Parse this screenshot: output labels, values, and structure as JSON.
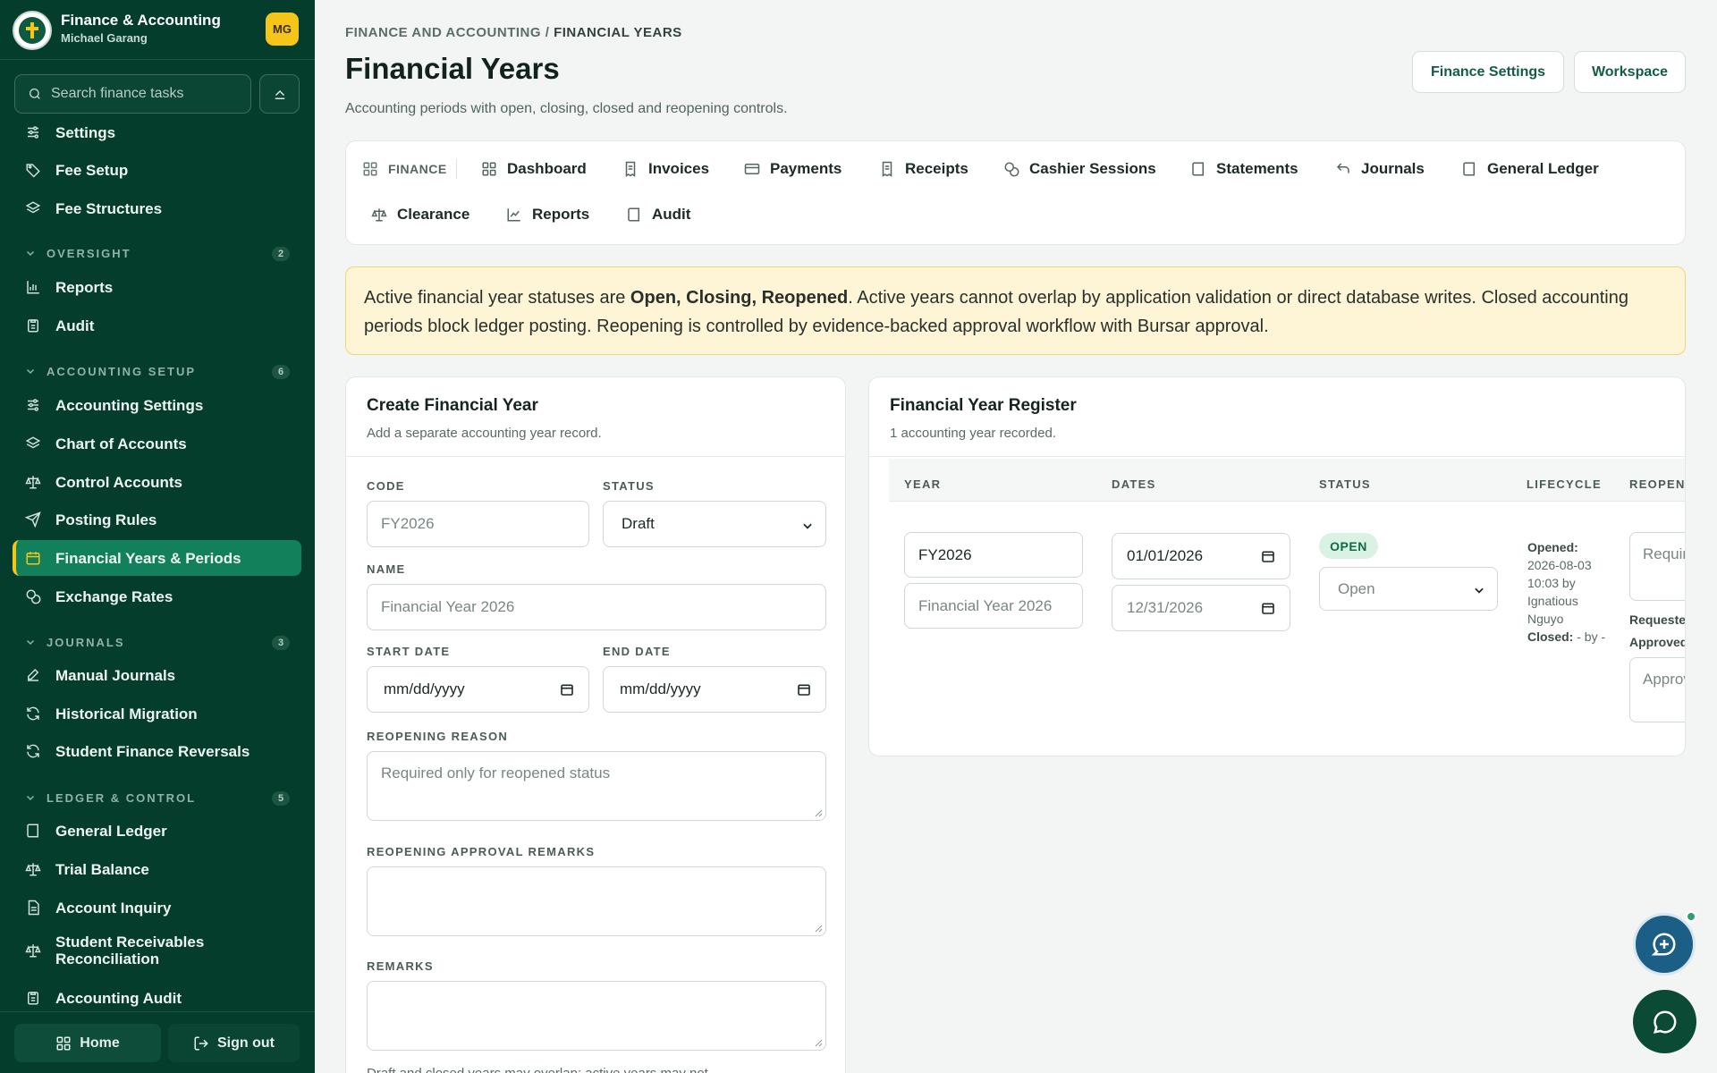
{
  "app": {
    "title": "Finance & Accounting",
    "user": "Michael Garang",
    "initials": "MG"
  },
  "sidebar": {
    "search_placeholder": "Search finance tasks",
    "top_items": [
      {
        "label": "Settings",
        "icon": "sliders-icon"
      },
      {
        "label": "Fee Setup",
        "icon": "tag-icon"
      },
      {
        "label": "Fee Structures",
        "icon": "layers-icon"
      }
    ],
    "sections": [
      {
        "label": "OVERSIGHT",
        "count": "2",
        "items": [
          {
            "label": "Reports",
            "icon": "bar-chart-icon"
          },
          {
            "label": "Audit",
            "icon": "clipboard-icon"
          }
        ]
      },
      {
        "label": "ACCOUNTING SETUP",
        "count": "6",
        "items": [
          {
            "label": "Accounting Settings",
            "icon": "sliders-icon"
          },
          {
            "label": "Chart of Accounts",
            "icon": "layers-icon"
          },
          {
            "label": "Control Accounts",
            "icon": "scale-icon"
          },
          {
            "label": "Posting Rules",
            "icon": "send-icon"
          },
          {
            "label": "Financial Years & Periods",
            "icon": "calendar-icon",
            "active": true
          },
          {
            "label": "Exchange Rates",
            "icon": "coins-icon"
          }
        ]
      },
      {
        "label": "JOURNALS",
        "count": "3",
        "items": [
          {
            "label": "Manual Journals",
            "icon": "pen-icon"
          },
          {
            "label": "Historical Migration",
            "icon": "refresh-icon"
          },
          {
            "label": "Student Finance Reversals",
            "icon": "refresh-icon"
          }
        ]
      },
      {
        "label": "LEDGER & CONTROL",
        "count": "5",
        "items": [
          {
            "label": "General Ledger",
            "icon": "book-icon"
          },
          {
            "label": "Trial Balance",
            "icon": "scale-icon"
          },
          {
            "label": "Account Inquiry",
            "icon": "file-text-icon"
          },
          {
            "label": "Student Receivables Reconciliation",
            "icon": "scale-icon"
          },
          {
            "label": "Accounting Audit",
            "icon": "clipboard-icon"
          }
        ]
      }
    ],
    "footer": {
      "home": "Home",
      "signout": "Sign out"
    }
  },
  "header": {
    "breadcrumb_parent": "FINANCE AND ACCOUNTING",
    "breadcrumb_sep": " / ",
    "breadcrumb_current": "FINANCIAL YEARS",
    "title": "Financial Years",
    "subtitle": "Accounting periods with open, closing, closed and reopening controls.",
    "btn_settings": "Finance Settings",
    "btn_workspace": "Workspace"
  },
  "tabs": [
    {
      "label": "FINANCE",
      "icon": "grid-icon"
    },
    {
      "label": "Dashboard",
      "icon": "grid-icon"
    },
    {
      "label": "Invoices",
      "icon": "receipt-icon"
    },
    {
      "label": "Payments",
      "icon": "credit-card-icon"
    },
    {
      "label": "Receipts",
      "icon": "receipt-icon"
    },
    {
      "label": "Cashier Sessions",
      "icon": "coins-icon"
    },
    {
      "label": "Statements",
      "icon": "book-icon"
    },
    {
      "label": "Journals",
      "icon": "undo-icon"
    },
    {
      "label": "General Ledger",
      "icon": "book-icon"
    },
    {
      "label": "Clearance",
      "icon": "scale-icon"
    },
    {
      "label": "Reports",
      "icon": "line-chart-icon"
    },
    {
      "label": "Audit",
      "icon": "book-icon"
    }
  ],
  "notice": {
    "text_before": "Active financial year statuses are ",
    "bold": "Open, Closing, Reopened",
    "text_after": ". Active years cannot overlap by application validation or direct database writes. Closed accounting periods block ledger posting. Reopening is controlled by evidence-backed approval workflow with Bursar approval."
  },
  "create_form": {
    "title": "Create Financial Year",
    "subtitle": "Add a separate accounting year record.",
    "code_label": "CODE",
    "code_placeholder": "FY2026",
    "status_label": "STATUS",
    "status_value": "Draft",
    "name_label": "NAME",
    "name_placeholder": "Financial Year 2026",
    "start_label": "START DATE",
    "start_placeholder": "mm/dd/yyyy",
    "end_label": "END DATE",
    "end_placeholder": "mm/dd/yyyy",
    "reopen_reason_label": "REOPENING REASON",
    "reopen_reason_placeholder": "Required only for reopened status",
    "reopen_approval_label": "REOPENING APPROVAL REMARKS",
    "remarks_label": "REMARKS",
    "footnote": "Draft and closed years may overlap; active years may not."
  },
  "register": {
    "title": "Financial Year Register",
    "subtitle": "1 accounting year recorded.",
    "columns": [
      "YEAR",
      "DATES",
      "STATUS",
      "LIFECYCLE",
      "REOPEN"
    ],
    "row": {
      "code": "FY2026",
      "name": "Financial Year 2026",
      "start": "01/01/2026",
      "end": "12/31/2026",
      "status_badge": "OPEN",
      "status_value": "Open",
      "opened_label": "Opened:",
      "opened_text": "2026-08-03 10:03 by Ignatious Nguyo",
      "closed_label": "Closed:",
      "closed_text": "- by -",
      "reopen_reason_placeholder": "Required",
      "requested_label": "Requested",
      "approved_label": "Approved",
      "approval_placeholder": "Approval"
    }
  },
  "colors": {
    "sidebar": "#053d2d",
    "accent": "#12805a",
    "highlight": "#f5c518",
    "brand_text": "#135c42",
    "notice_bg": "#fdf5d6"
  }
}
